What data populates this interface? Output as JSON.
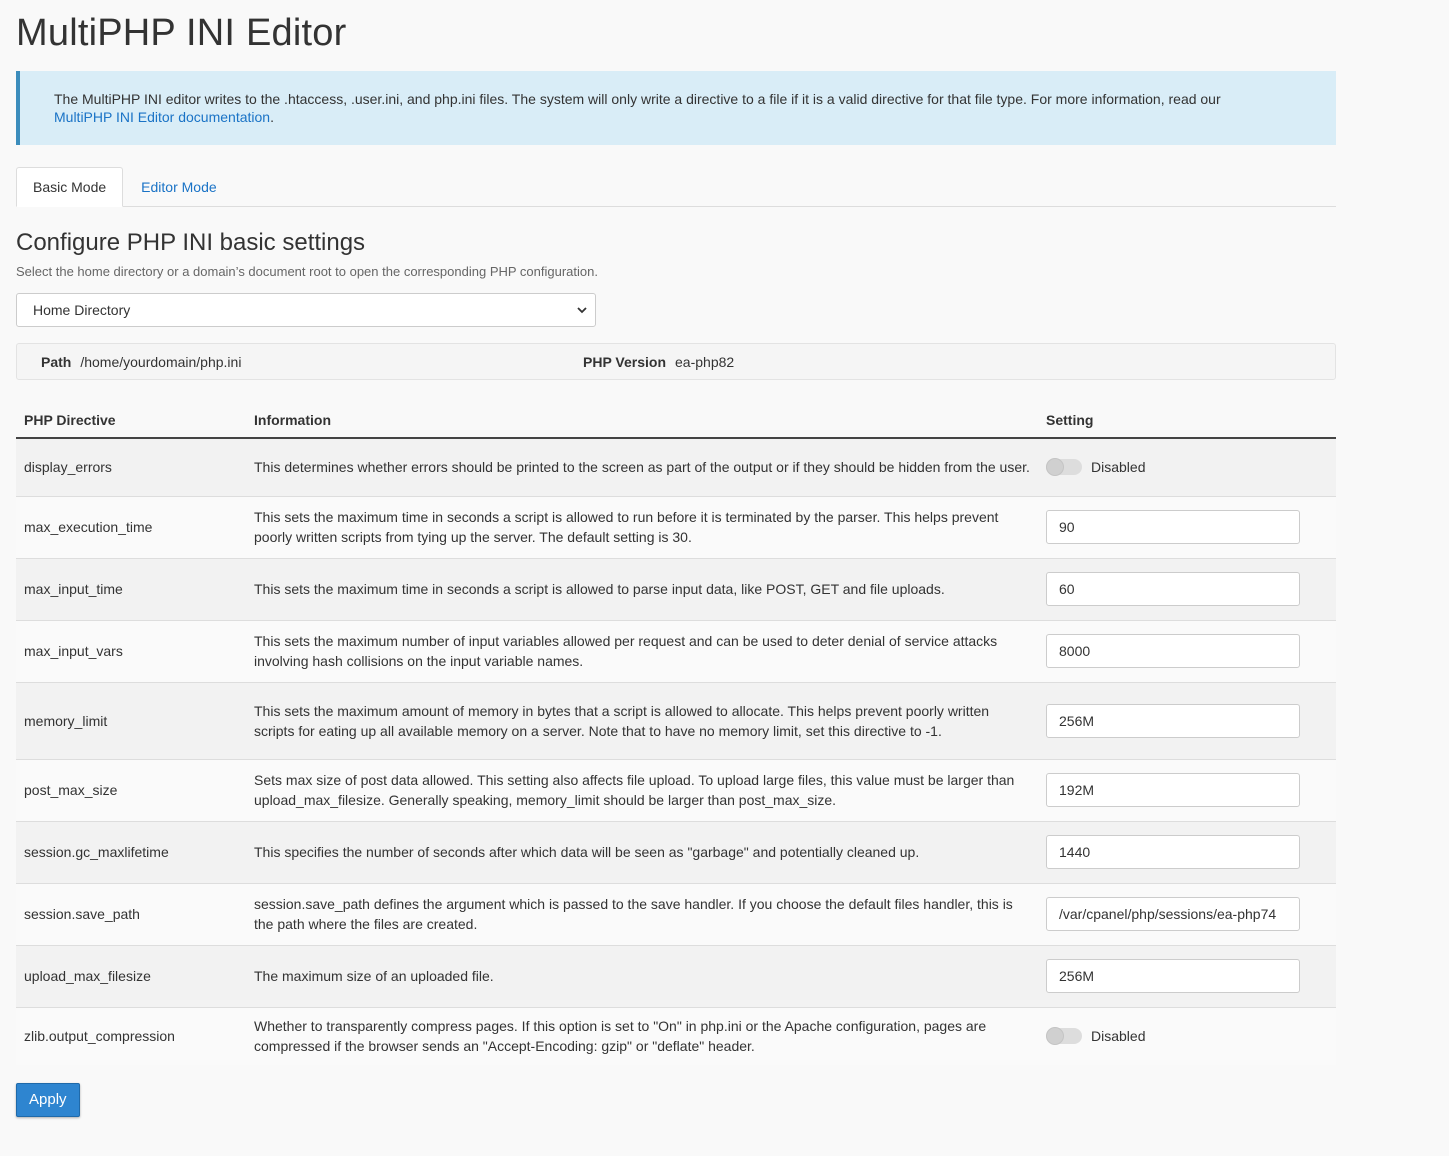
{
  "page": {
    "title": "MultiPHP INI Editor"
  },
  "callout": {
    "text": "The MultiPHP INI editor writes to the .htaccess, .user.ini, and php.ini files. The system will only write a directive to a file if it is a valid directive for that file type. For more information, read our ",
    "link": "MultiPHP INI Editor documentation",
    "suffix": "."
  },
  "tabs": [
    {
      "label": "Basic Mode",
      "active": true
    },
    {
      "label": "Editor Mode",
      "active": false
    }
  ],
  "section": {
    "title": "Configure PHP INI basic settings",
    "subtitle": "Select the home directory or a domain’s document root to open the corresponding PHP configuration.",
    "select_value": "Home Directory"
  },
  "info": {
    "path_label": "Path",
    "path_value": "/home/yourdomain/php.ini",
    "version_label": "PHP Version",
    "version_value": "ea-php82"
  },
  "table": {
    "headers": [
      "PHP Directive",
      "Information",
      "Setting"
    ],
    "rows": [
      {
        "directive": "display_errors",
        "info": "This determines whether errors should be printed to the screen as part of the output or if they should be hidden from the user.",
        "type": "toggle",
        "value": "Disabled"
      },
      {
        "directive": "max_execution_time",
        "info": "This sets the maximum time in seconds a script is allowed to run before it is terminated by the parser. This helps prevent poorly written scripts from tying up the server. The default setting is 30.",
        "type": "input",
        "value": "90"
      },
      {
        "directive": "max_input_time",
        "info": "This sets the maximum time in seconds a script is allowed to parse input data, like POST, GET and file uploads.",
        "type": "input",
        "value": "60"
      },
      {
        "directive": "max_input_vars",
        "info": "This sets the maximum number of input variables allowed per request and can be used to deter denial of service attacks involving hash collisions on the input variable names.",
        "type": "input",
        "value": "8000"
      },
      {
        "directive": "memory_limit",
        "info": "This sets the maximum amount of memory in bytes that a script is allowed to allocate. This helps prevent poorly written scripts for eating up all available memory on a server. Note that to have no memory limit, set this directive to -1.",
        "type": "input",
        "value": "256M"
      },
      {
        "directive": "post_max_size",
        "info": "Sets max size of post data allowed. This setting also affects file upload. To upload large files, this value must be larger than upload_max_filesize. Generally speaking, memory_limit should be larger than post_max_size.",
        "type": "input",
        "value": "192M"
      },
      {
        "directive": "session.gc_maxlifetime",
        "info": "This specifies the number of seconds after which data will be seen as \"garbage\" and potentially cleaned up.",
        "type": "input",
        "value": "1440"
      },
      {
        "directive": "session.save_path",
        "info": "session.save_path defines the argument which is passed to the save handler. If you choose the default files handler, this is the path where the files are created.",
        "type": "input",
        "value": "/var/cpanel/php/sessions/ea-php74"
      },
      {
        "directive": "upload_max_filesize",
        "info": "The maximum size of an uploaded file.",
        "type": "input",
        "value": "256M"
      },
      {
        "directive": "zlib.output_compression",
        "info": "Whether to transparently compress pages. If this option is set to \"On\" in php.ini or the Apache configuration, pages are compressed if the browser sends an \"Accept-Encoding: gzip\" or \"deflate\" header.",
        "type": "toggle",
        "value": "Disabled"
      }
    ]
  },
  "apply_label": "Apply"
}
